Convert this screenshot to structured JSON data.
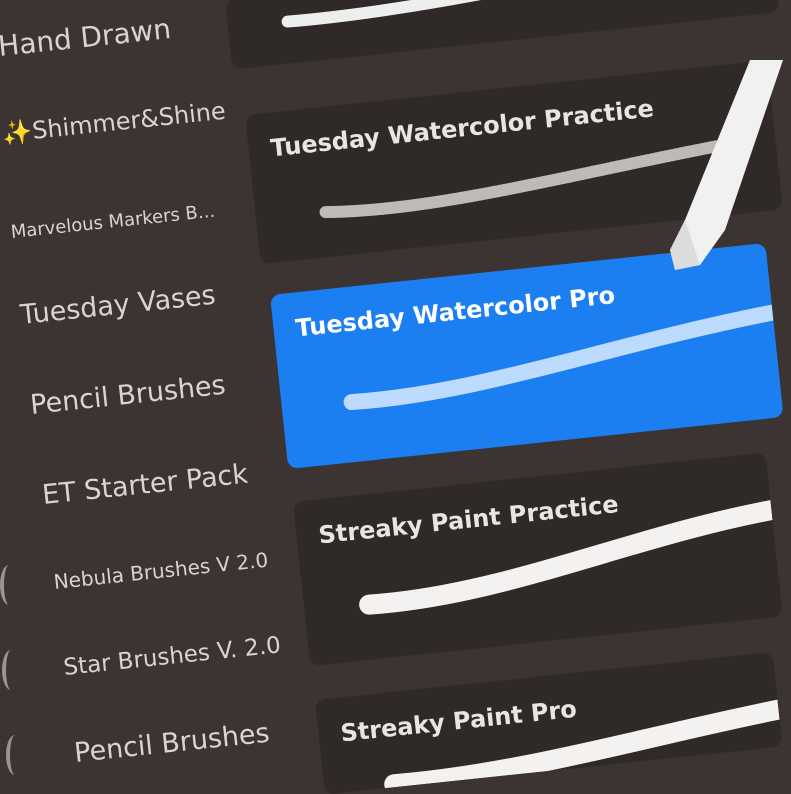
{
  "libraries": [
    {
      "label": "Hand Drawn"
    },
    {
      "label": "Shimmer&Shine",
      "icon": "sparkles-icon"
    },
    {
      "label": "Marvelous Markers B..."
    },
    {
      "label": "Tuesday Vases"
    },
    {
      "label": "Pencil Brushes"
    },
    {
      "label": "ET Starter Pack"
    },
    {
      "label": "Nebula Brushes V 2.0"
    },
    {
      "label": "Star Brushes V. 2.0"
    },
    {
      "label": "Pencil Brushes"
    }
  ],
  "brushes": [
    {
      "name": "Tuesday Watercolor Practice",
      "selected": false
    },
    {
      "name": "Tuesday Watercolor Pro",
      "selected": true
    },
    {
      "name": "Streaky Paint Practice",
      "selected": false
    },
    {
      "name": "Streaky Paint Pro",
      "selected": false
    }
  ],
  "colors": {
    "background": "#3b3432",
    "card": "#2f2927",
    "selected": "#1b7ff2"
  }
}
